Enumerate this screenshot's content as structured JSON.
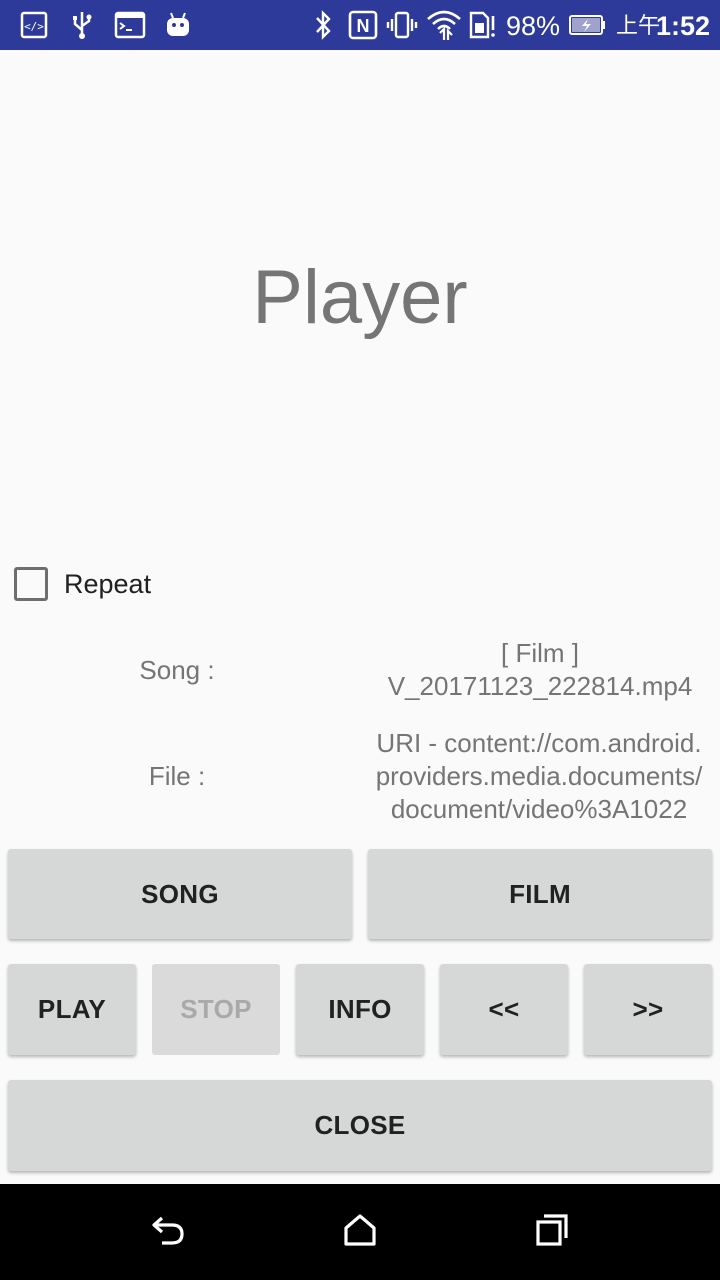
{
  "status_bar": {
    "battery_percent": "98%",
    "time_prefix": "上午",
    "time": "1:52",
    "background": "#2d3a9a"
  },
  "title": "Player",
  "repeat": {
    "label": "Repeat",
    "checked": false
  },
  "song": {
    "label": "Song :",
    "value_line1": "[ Film ]",
    "value_line2": "V_20171123_222814.mp4"
  },
  "file": {
    "label": "File :",
    "value_line1": "URI - content://com.android.",
    "value_line2": "providers.media.documents/",
    "value_line3": "document/video%3A1022"
  },
  "buttons": {
    "song": "SONG",
    "film": "FILM",
    "play": "PLAY",
    "stop": "STOP",
    "info": "INFO",
    "prev": "<<",
    "next": ">>",
    "close": "CLOSE"
  },
  "icons": {
    "status_left": [
      "developer-icon",
      "usb-icon",
      "terminal-icon",
      "android-icon"
    ],
    "status_right": [
      "bluetooth-icon",
      "nfc-icon",
      "vibrate-icon",
      "wifi-icon",
      "sim-icon",
      "battery-icon"
    ],
    "nav": [
      "back-icon",
      "home-icon",
      "recents-icon"
    ]
  }
}
